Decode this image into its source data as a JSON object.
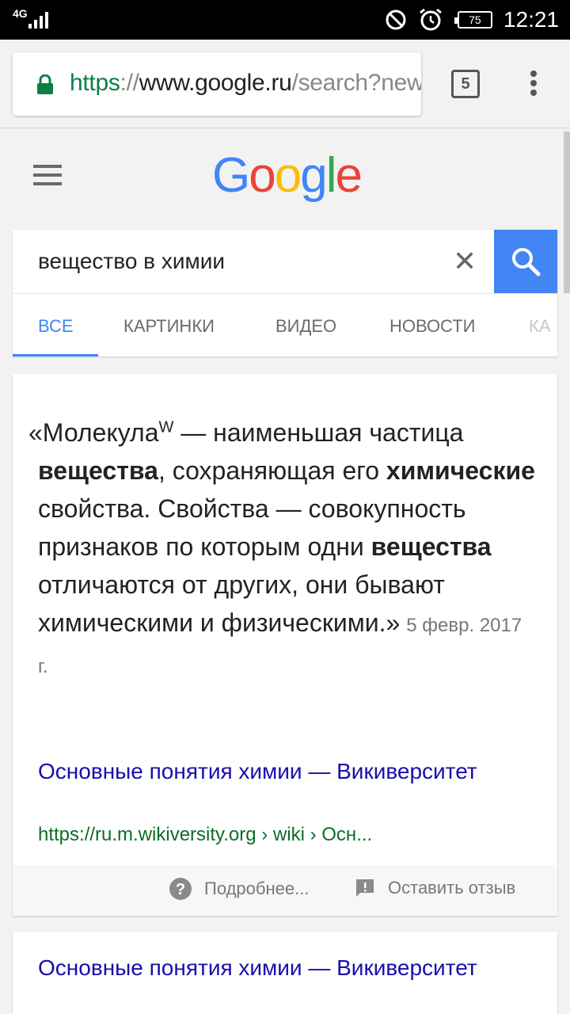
{
  "status": {
    "network": "4G",
    "battery": "75",
    "time": "12:21"
  },
  "browser": {
    "url_scheme": "https",
    "url_sep": "://",
    "url_host": "www.google.ru",
    "url_path": "/search?new",
    "tab_count": "5"
  },
  "google": {
    "logo": [
      "G",
      "o",
      "o",
      "g",
      "l",
      "e"
    ],
    "query": "вещество в химии",
    "tabs": [
      "ВСЕ",
      "КАРТИНКИ",
      "ВИДЕО",
      "НОВОСТИ",
      "КА"
    ]
  },
  "featured": {
    "open_quote": "«Молекула",
    "sup": "W",
    "t1": " — наименьшая частица ",
    "b1": "вещества",
    "t2": ", сохраняющая его ",
    "b2": "химические",
    "t3": " свойства. Свойства — совокупность признаков по которым одни ",
    "b3": "вещества",
    "t4": " отличаются от других, они бывают химическими и физическими.»",
    "date": "5 февр. 2017 г.",
    "title": "Основные понятия химии — Викиверситет",
    "url": "https://ru.m.wikiversity.org › wiki › Осн...",
    "more": "Подробнее...",
    "feedback": "Оставить отзыв"
  },
  "result2": {
    "title": "Основные понятия химии — Викиверситет"
  }
}
